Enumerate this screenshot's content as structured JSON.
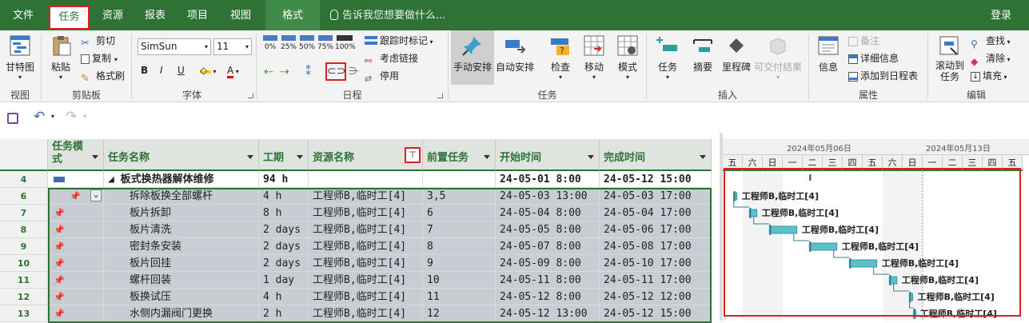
{
  "tabs": {
    "file": "文件",
    "task": "任务",
    "resource": "资源",
    "report": "报表",
    "project": "项目",
    "view": "视图",
    "format": "格式",
    "tell_me": "告诉我您想要做什么...",
    "login": "登录"
  },
  "ribbon": {
    "view_group": {
      "gantt": "甘特图",
      "label": "视图"
    },
    "clipboard": {
      "paste": "粘贴",
      "cut": "剪切",
      "copy": "复制",
      "format_painter": "格式刷",
      "label": "剪贴板"
    },
    "font": {
      "font_name": "SimSun",
      "font_size": "11",
      "bold": "B",
      "italic": "I",
      "underline": "U",
      "label": "字体"
    },
    "schedule": {
      "pct0": "0%",
      "pct25": "25%",
      "pct50": "50%",
      "pct75": "75%",
      "pct100": "100%",
      "track": "跟踪时标记",
      "respect_links": "考虑链接",
      "inactivate": "停用",
      "label": "日程"
    },
    "tasks": {
      "manual": "手动安排",
      "auto": "自动安排",
      "inspect": "检查",
      "move": "移动",
      "mode": "模式",
      "label": "任务"
    },
    "insert": {
      "task": "任务",
      "summary": "摘要",
      "milestone": "里程碑",
      "deliverable": "可交付结果",
      "label": "插入"
    },
    "properties": {
      "info": "信息",
      "notes": "备注",
      "details": "详细信息",
      "add_timeline": "添加到日程表",
      "label": "属性"
    },
    "editing": {
      "scroll_line1": "滚动到",
      "scroll_line2": "任务",
      "find": "查找",
      "clear": "清除",
      "fill": "填充",
      "label": "编辑"
    }
  },
  "table": {
    "headers": {
      "mode_line1": "任务模",
      "mode_line2": "式",
      "name": "任务名称",
      "duration": "工期",
      "resource": "资源名称",
      "predecessors": "前置任务",
      "start": "开始时间",
      "finish": "完成时间"
    },
    "rows": [
      {
        "id": "4",
        "name": "◢ 板式换热器解体维修",
        "duration": "94 h",
        "resource": "",
        "pred": "",
        "start": "24-05-01 8:00",
        "finish": "24-05-12 15:00"
      },
      {
        "id": "6",
        "name": "拆除板换全部螺杆",
        "duration": "4 h",
        "resource": "工程师B,临时工[4]",
        "pred": "3,5",
        "start": "24-05-03 13:00",
        "finish": "24-05-03 17:00"
      },
      {
        "id": "7",
        "name": "板片拆卸",
        "duration": "8 h",
        "resource": "工程师B,临时工[4]",
        "pred": "6",
        "start": "24-05-04 8:00",
        "finish": "24-05-04 17:00"
      },
      {
        "id": "8",
        "name": "板片清洗",
        "duration": "2 days",
        "resource": "工程师B,临时工[4]",
        "pred": "7",
        "start": "24-05-05 8:00",
        "finish": "24-05-06 17:00"
      },
      {
        "id": "9",
        "name": "密封条安装",
        "duration": "2 days",
        "resource": "工程师B,临时工[4]",
        "pred": "8",
        "start": "24-05-07 8:00",
        "finish": "24-05-08 17:00"
      },
      {
        "id": "10",
        "name": "板片回挂",
        "duration": "2 days",
        "resource": "工程师B,临时工[4]",
        "pred": "9",
        "start": "24-05-09 8:00",
        "finish": "24-05-10 17:00"
      },
      {
        "id": "11",
        "name": "螺杆回装",
        "duration": "1 day",
        "resource": "工程师B,临时工[4]",
        "pred": "10",
        "start": "24-05-11 8:00",
        "finish": "24-05-11 17:00"
      },
      {
        "id": "12",
        "name": "板换试压",
        "duration": "4 h",
        "resource": "工程师B,临时工[4]",
        "pred": "11",
        "start": "24-05-12 8:00",
        "finish": "24-05-12 12:00"
      },
      {
        "id": "13",
        "name": "水侧内漏阀门更换",
        "duration": "2 h",
        "resource": "工程师B,临时工[4]",
        "pred": "12",
        "start": "24-05-12 13:00",
        "finish": "24-05-12 15:00"
      }
    ]
  },
  "gantt": {
    "week1": "2024年05月06日",
    "week2": "2024年05月13日",
    "days": [
      "五",
      "六",
      "日",
      "一",
      "二",
      "三",
      "四",
      "五",
      "六",
      "日",
      "一",
      "二",
      "三",
      "四",
      "五"
    ],
    "bar_label": "工程师B,临时工[4]"
  },
  "colors": {
    "accent": "#2e7236",
    "bar": "#5bc0c9",
    "highlight": "#e0201e"
  }
}
